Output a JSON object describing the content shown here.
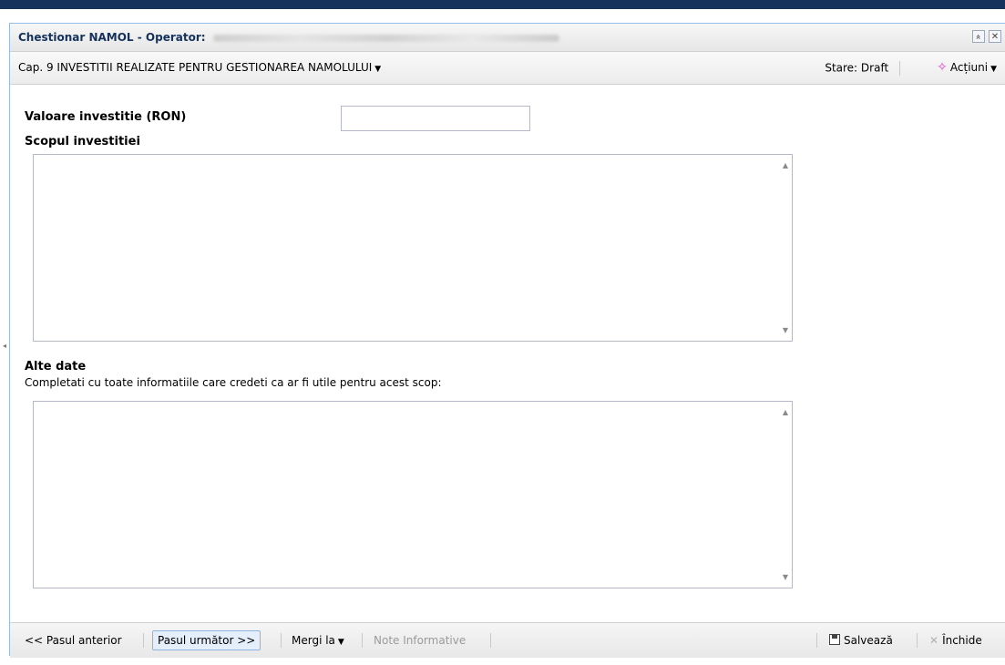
{
  "window": {
    "title": "Chestionar NAMOL - Operator:",
    "collapse_symbol": "»",
    "close_symbol": "✕"
  },
  "toolbar": {
    "chapter": "Cap. 9 INVESTITII REALIZATE PENTRU GESTIONAREA NAMOLULUI",
    "status": "Stare: Draft",
    "actions": "Acțiuni"
  },
  "form": {
    "investment_value_label": "Valoare investitie (RON)",
    "investment_value": "",
    "purpose_label": "Scopul investitiei",
    "purpose_value": "",
    "other_label": "Alte date",
    "other_description": "Completati cu toate informatiile care credeti ca ar fi utile pentru acest scop:",
    "other_value": ""
  },
  "footer": {
    "prev": "<< Pasul anterior",
    "next": "Pasul următor >>",
    "goto": "Mergi la",
    "notes": "Note Informative",
    "save": "Salvează",
    "close": "Închide"
  },
  "colors": {
    "top_bar": "#15325c",
    "title_text": "#15325c",
    "active_button_bg": "#e4effb"
  },
  "icons": {
    "actions": "sparkle-icon",
    "save": "floppy-disk-icon",
    "close": "x-icon"
  }
}
